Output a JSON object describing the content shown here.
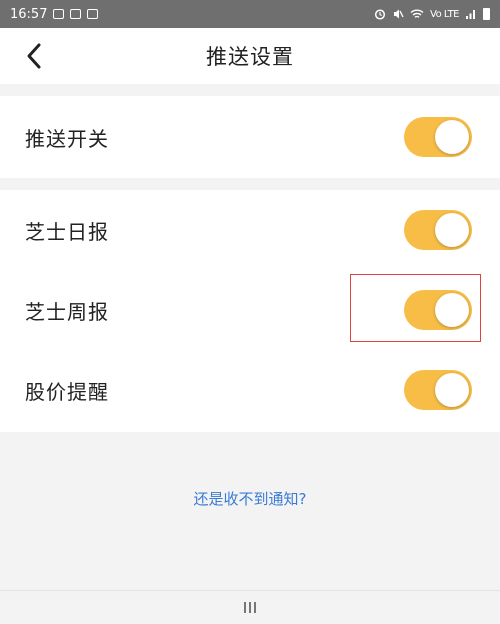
{
  "status_bar": {
    "time": "16:57",
    "right_text": "Vo LTE"
  },
  "header": {
    "title": "推送设置"
  },
  "settings": {
    "master": {
      "label": "推送开关",
      "enabled": true
    },
    "items": [
      {
        "label": "芝士日报",
        "enabled": true
      },
      {
        "label": "芝士周报",
        "enabled": true
      },
      {
        "label": "股价提醒",
        "enabled": true
      }
    ]
  },
  "help_link": "还是收不到通知?",
  "colors": {
    "toggle_on": "#f7bd47",
    "link": "#3a7bd5",
    "highlight": "#e04040"
  }
}
